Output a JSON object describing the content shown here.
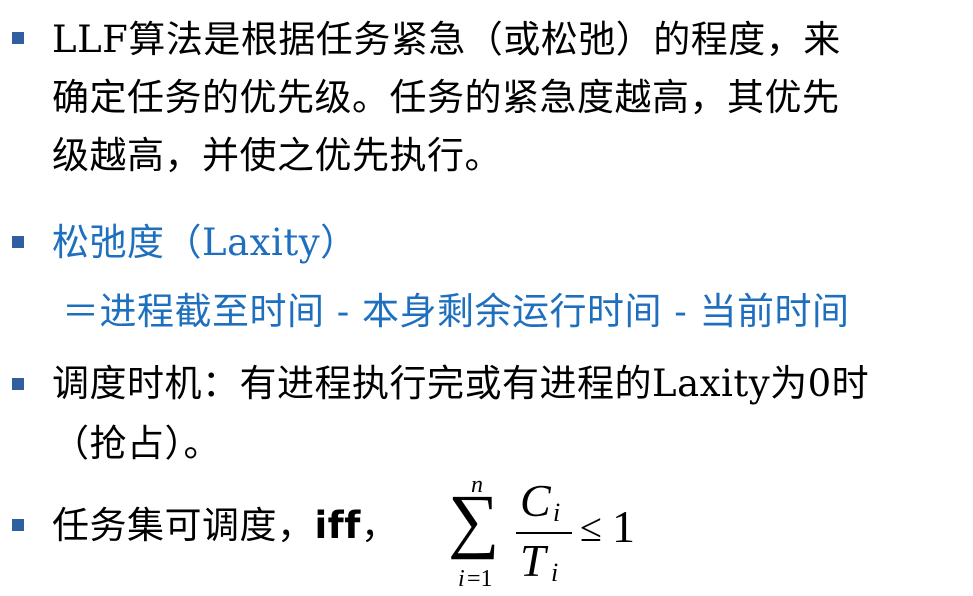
{
  "colors": {
    "bullet": "#2f5f9e",
    "blue_text": "#1f6fbf",
    "text": "#000000"
  },
  "bullets": [
    {
      "lines": [
        "LLF算法是根据任务紧急（或松弛）的程度，来",
        "确定任务的优先级。任务的紧急度越高，其优先",
        "级越高，并使之优先执行。"
      ]
    },
    {
      "lines": [
        "松弛度（Laxity）",
        "＝进程截至时间 - 本身剩余运行时间 - 当前时间"
      ]
    },
    {
      "lines": [
        "调度时机：有进程执行完或有进程的Laxity为0时",
        "（抢占）。"
      ]
    },
    {
      "prefix": "任务集可调度，",
      "bold": "iff",
      "suffix": "，"
    }
  ],
  "formula": {
    "sum_symbol": "∑",
    "upper": "n",
    "lower_var": "i",
    "lower_eq": "=1",
    "num": "C",
    "num_sub": "i",
    "den": "T",
    "den_sub": "i",
    "relation": "≤",
    "rhs": "1"
  }
}
